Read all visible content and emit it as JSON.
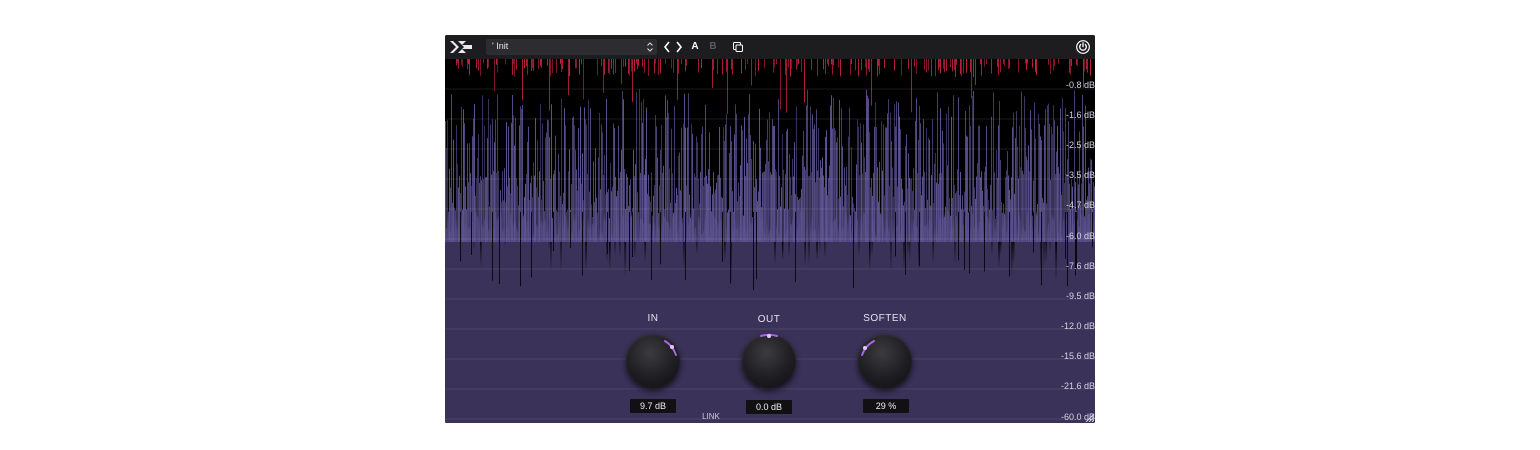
{
  "window": {
    "preset": "' Init",
    "ab": {
      "a": "A",
      "b": "B"
    }
  },
  "scale": [
    "-0.8 dB",
    "-1.6 dB",
    "-2.5 dB",
    "-3.5 dB",
    "-4.7 dB",
    "-6.0 dB",
    "-7.6 dB",
    "-9.5 dB",
    "-12.0 dB",
    "-15.6 dB",
    "-21.6 dB",
    "-60.0 dB"
  ],
  "controls": {
    "in": {
      "label": "IN",
      "value": "9.7 dB"
    },
    "out": {
      "label": "OUT",
      "value": "0.0 dB"
    },
    "soften": {
      "label": "SOFTEN",
      "value": "29 %"
    },
    "link": {
      "label": "LINK",
      "dash": "-"
    }
  },
  "colors": {
    "background": "#3a3258",
    "waveform": "#5d5391",
    "clip": "#c2223f",
    "accent": "#b46cff"
  },
  "icons": [
    "logo-icon",
    "updown-icon",
    "chevron-left-icon",
    "chevron-right-icon",
    "copy-icon",
    "power-icon",
    "resize-grip-icon"
  ]
}
